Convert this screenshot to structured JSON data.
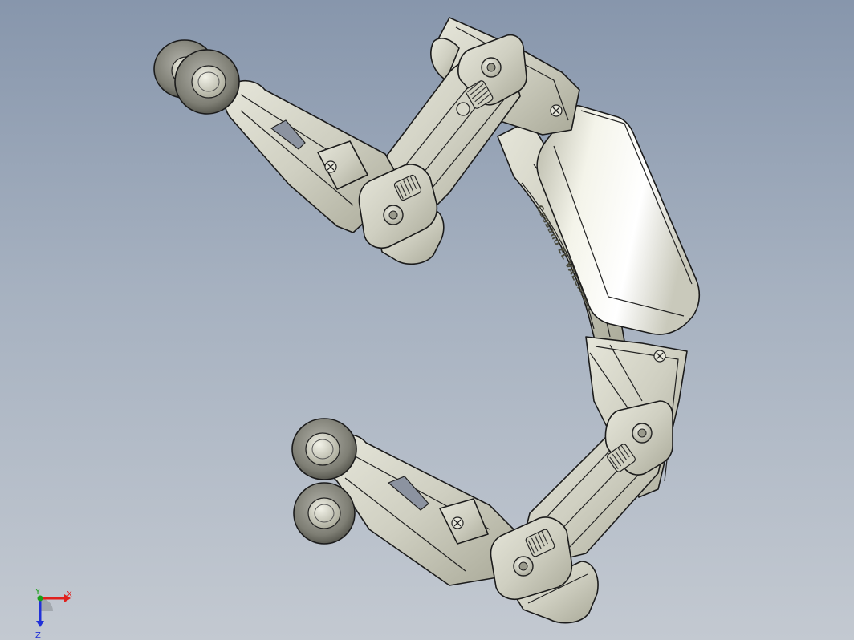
{
  "viewport": {
    "background_top": "#8796ac",
    "background_bottom": "#c3c9d1"
  },
  "model": {
    "engraving": "Cassano EL VALLINATI",
    "part_color": "#d2d2c4",
    "part_shade": "#aeae9e",
    "wheel_color": "#8a8a80",
    "battery_color": "#e4e4d6"
  },
  "triad": {
    "x_label": "X",
    "y_label": "Y",
    "z_label": "Z",
    "x_color": "#e0201c",
    "y_color": "#1aa01a",
    "z_color": "#2030d8"
  }
}
